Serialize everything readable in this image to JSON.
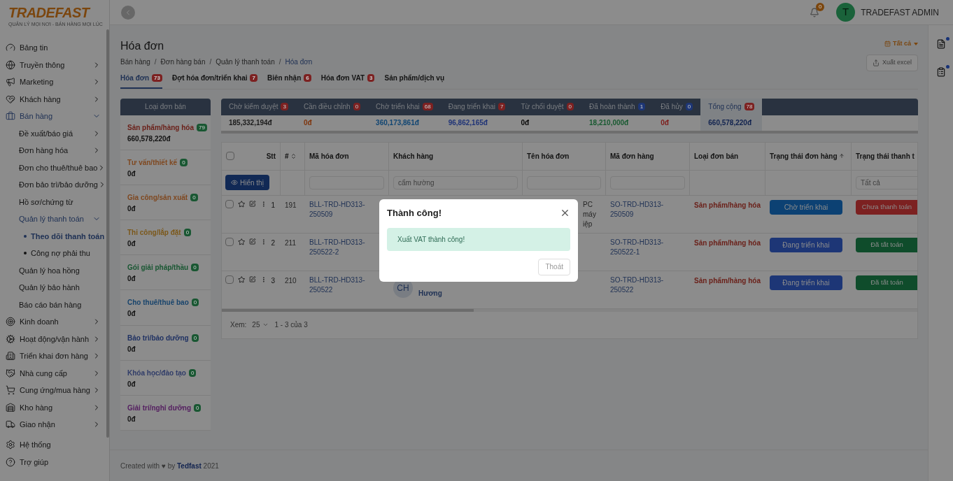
{
  "brand": {
    "name": "TRADEFAST",
    "tagline": "QUẢN LÝ MỌI NƠI - BÁN HÀNG MỌI LÚC"
  },
  "header": {
    "notification_count": "0",
    "avatar_letter": "T",
    "user": "TRADEFAST ADMIN"
  },
  "sidebar": {
    "items": [
      {
        "label": "Bảng tin",
        "selected": false
      },
      {
        "label": "Truyền thông",
        "selected": false,
        "expanded": false
      },
      {
        "label": "Marketing",
        "selected": false,
        "expanded": false
      },
      {
        "label": "Khách hàng",
        "selected": false,
        "expanded": false
      },
      {
        "label": "Bán hàng",
        "selected": true,
        "expanded": true,
        "children": [
          {
            "label": "Đề xuất/báo giá",
            "selected": false,
            "expanded": false
          },
          {
            "label": "Đơn hàng hóa",
            "selected": false,
            "expanded": false
          },
          {
            "label": "Đơn cho thuê/thuê bao",
            "selected": false,
            "expanded": false
          },
          {
            "label": "Đơn bảo trì/bảo dưỡng",
            "selected": false,
            "expanded": false
          },
          {
            "label": "Hồ sơ/chứng từ",
            "selected": false
          },
          {
            "label": "Quản lý thanh toán",
            "selected": true,
            "expanded": true,
            "children": [
              {
                "label": "Theo dõi thanh toán",
                "selected": true
              },
              {
                "label": "Công nợ phải thu",
                "selected": false
              }
            ]
          },
          {
            "label": "Quản lý hoa hồng",
            "selected": false
          },
          {
            "label": "Quản lý bảo hành",
            "selected": false
          },
          {
            "label": "Báo cáo bán hàng",
            "selected": false
          }
        ]
      },
      {
        "label": "Kinh doanh",
        "selected": false,
        "expanded": false
      },
      {
        "label": "Hoạt động/vận hành",
        "selected": false,
        "expanded": false
      },
      {
        "label": "Triển khai đơn hàng",
        "selected": false,
        "expanded": false
      },
      {
        "label": "Nhà cung cấp",
        "selected": false,
        "expanded": false
      },
      {
        "label": "Cung ứng/mua hàng",
        "selected": false,
        "expanded": false
      },
      {
        "label": "Kho hàng",
        "selected": false,
        "expanded": false
      },
      {
        "label": "Giao nhận",
        "selected": false,
        "expanded": false
      }
    ],
    "bottom": [
      {
        "label": "Hệ thống"
      },
      {
        "label": "Trợ giúp"
      }
    ]
  },
  "page": {
    "title": "Hóa đơn",
    "breadcrumb_separator": "/",
    "breadcrumb": [
      {
        "label": "Bán hàng",
        "current": false
      },
      {
        "label": "Đơn hàng bán",
        "current": false
      },
      {
        "label": "Quản lý thanh toán",
        "current": false
      },
      {
        "label": "Hóa đơn",
        "current": true
      }
    ],
    "period": "Tất cả",
    "export": "Xuất excel"
  },
  "tabs": [
    {
      "label": "Hóa đơn",
      "count": "73",
      "selected": true
    },
    {
      "label": "Đợt hóa đơn/triển khai",
      "count": "7",
      "selected": false
    },
    {
      "label": "Biên nhận",
      "count": "6",
      "selected": false
    },
    {
      "label": "Hóa đơn VAT",
      "count": "3",
      "selected": false
    },
    {
      "label": "Sản phẩm/dịch vụ",
      "selected": false
    }
  ],
  "order_types": {
    "title": "Loại đơn bán",
    "items": [
      {
        "label": "Sản phẩm/hàng hóa",
        "count": "79",
        "amount": "660,578,220đ",
        "color": "#6a1f18"
      },
      {
        "label": "Tư vấn/thiết kế",
        "count": "0",
        "amount": "0đ",
        "color": "#7f4820"
      },
      {
        "label": "Gia công/sản xuất",
        "count": "0",
        "amount": "0đ",
        "color": "#7f4820"
      },
      {
        "label": "Thi công/lắp đặt",
        "count": "0",
        "amount": "0đ",
        "color": "#7b581a"
      },
      {
        "label": "Gói giải pháp/thầu",
        "count": "0",
        "amount": "0đ",
        "color": "#195732"
      },
      {
        "label": "Cho thuê/thuê bao",
        "count": "0",
        "amount": "0đ",
        "color": "#18446c"
      },
      {
        "label": "Bảo trì/bảo dưỡng",
        "count": "0",
        "amount": "0đ",
        "color": "#203263"
      },
      {
        "label": "Khóa học/đào tạo",
        "count": "0",
        "amount": "0đ",
        "color": "#313d69"
      },
      {
        "label": "Giải trí/nghỉ dưỡng",
        "count": "0",
        "amount": "0đ",
        "color": "#552061"
      }
    ]
  },
  "summary": [
    {
      "label": "Chờ kiểm duyệt",
      "count": "3",
      "amount": "185,332,194đ",
      "color": "#1c1c1c",
      "selected": false
    },
    {
      "label": "Cần điều chỉnh",
      "count": "0",
      "amount": "0đ",
      "color": "#7f360e",
      "selected": false
    },
    {
      "label": "Chờ triển khai",
      "count": "68",
      "amount": "360,173,861đ",
      "color": "#114673",
      "selected": false
    },
    {
      "label": "Đang triển khai",
      "count": "7",
      "amount": "96,862,165đ",
      "color": "#203477",
      "selected": false
    },
    {
      "label": "Từ chối duyệt",
      "count": "0",
      "amount": "0đ",
      "color": "#090909",
      "selected": false
    },
    {
      "label": "Đã hoàn thành",
      "count": "1",
      "amount": "18,210,000đ",
      "color": "#195a31",
      "selected": false
    },
    {
      "label": "Đã hủy",
      "count": "0",
      "amount": "0đ",
      "color": "#7e1f1d",
      "selected": false
    },
    {
      "label": "Tổng cộng",
      "count": "78",
      "amount": "660,578,220đ",
      "color": "#11234f",
      "selected": true
    }
  ],
  "table": {
    "columns": [
      "Stt",
      "#",
      "Mã hóa đơn",
      "Khách hàng",
      "Tên hóa đơn",
      "Mã đơn hàng",
      "Loại đơn bán",
      "Trạng thái đơn hàng",
      "Trạng thái thanh t"
    ],
    "all_checked": false,
    "show_button": "Hiển thị",
    "customer_filter": "cẩm hường",
    "payment_filter": "Tất cả",
    "rows": [
      {
        "checked": false,
        "stt": "1",
        "num": "191",
        "code": "BLL-TRD-HD313-250509",
        "name_lines": [
          "PC",
          "máy",
          "iệp"
        ],
        "order": "SO-TRD-HD313-250509",
        "type": "Sản phẩm/hàng hóa",
        "status": {
          "label": "Chờ triển khai",
          "color": "#0c4173"
        },
        "payment": {
          "label": "Chưa thanh toán",
          "color": "#7c2121"
        }
      },
      {
        "checked": false,
        "stt": "2",
        "num": "211",
        "code": "BLL-TRD-HD313-250522-2",
        "order": "SO-TRD-HD313-250522-1",
        "type": "Sản phẩm/hàng hóa",
        "status": {
          "label": "Đang triển khai",
          "color": "#1d3676"
        },
        "payment": {
          "label": "Đã tất toán",
          "color": "#0f4c2b"
        }
      },
      {
        "checked": false,
        "stt": "3",
        "num": "210",
        "code": "BLL-TRD-HD313-250522",
        "customer": {
          "initials": "CH",
          "name": "Hương"
        },
        "order": "SO-TRD-HD313-250522",
        "type": "Sản phẩm/hàng hóa",
        "status": {
          "label": "Đang triển khai",
          "color": "#1d3676"
        },
        "payment": {
          "label": "Đã tất toán",
          "color": "#0f4c2b"
        }
      }
    ],
    "pagination": {
      "label": "Xem:",
      "page_size": "25",
      "range": "1 - 3 của 3"
    }
  },
  "footer": {
    "prefix": "Created with",
    "heart": "♥",
    "by": "by",
    "brand": "Tedfast",
    "year": "2021"
  },
  "modal": {
    "title": "Thành công!",
    "message": "Xuất VAT thành công!",
    "button": "Thoát"
  }
}
